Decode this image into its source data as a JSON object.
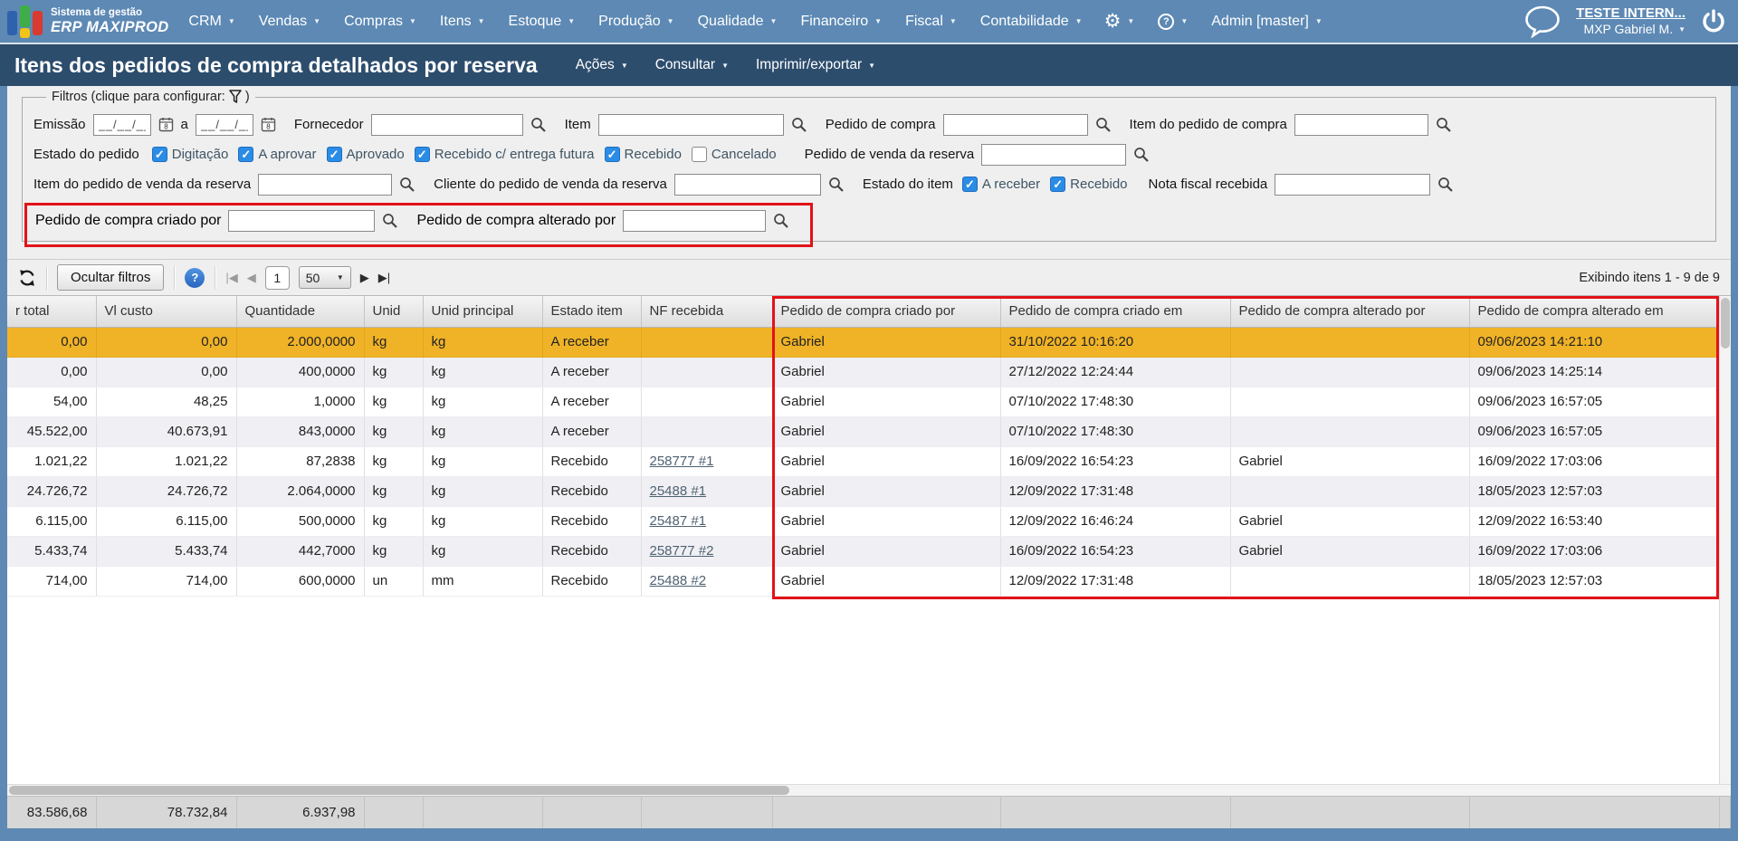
{
  "topnav": {
    "logo_line1": "Sistema de gestão",
    "logo_line2": "ERP MAXIPROD",
    "menus": [
      "CRM",
      "Vendas",
      "Compras",
      "Itens",
      "Estoque",
      "Produção",
      "Qualidade",
      "Financeiro",
      "Fiscal",
      "Contabilidade"
    ],
    "admin_menu": "Admin [master]",
    "account_link": "TESTE INTERN...",
    "user_name": "MXP Gabriel M."
  },
  "titlebar": {
    "title": "Itens dos pedidos de compra detalhados por reserva",
    "menus": [
      "Ações",
      "Consultar",
      "Imprimir/exportar"
    ]
  },
  "filters": {
    "legend_prefix": "Filtros (clique para configurar:",
    "legend_suffix": ")",
    "emissao_label": "Emissão",
    "emissao_from_value": "__/__/__",
    "emissao_to_label": "a",
    "emissao_to_value": "__/__/__",
    "fornecedor_label": "Fornecedor",
    "item_label": "Item",
    "pedido_compra_label": "Pedido de compra",
    "item_pedido_compra_label": "Item do pedido de compra",
    "estado_pedido": {
      "label": "Estado do pedido",
      "options": [
        {
          "label": "Digitação",
          "checked": true
        },
        {
          "label": "A aprovar",
          "checked": true
        },
        {
          "label": "Aprovado",
          "checked": true
        },
        {
          "label": "Recebido c/ entrega futura",
          "checked": true
        },
        {
          "label": "Recebido",
          "checked": true
        },
        {
          "label": "Cancelado",
          "checked": false
        }
      ]
    },
    "pedido_venda_reserva_label": "Pedido de venda da reserva",
    "item_pedido_venda_reserva_label": "Item do pedido de venda da reserva",
    "cliente_pedido_venda_reserva_label": "Cliente do pedido de venda da reserva",
    "estado_item": {
      "label": "Estado do item",
      "options": [
        {
          "label": "A receber",
          "checked": true
        },
        {
          "label": "Recebido",
          "checked": true
        }
      ]
    },
    "nota_fiscal_label": "Nota fiscal recebida",
    "criado_por_label": "Pedido de compra criado por",
    "alterado_por_label": "Pedido de compra alterado por"
  },
  "toolbar": {
    "hide_filters_label": "Ocultar filtros",
    "page_number": "1",
    "page_size": "50",
    "showing_text": "Exibindo itens 1 - 9 de 9"
  },
  "table": {
    "headers": [
      "r total",
      "Vl custo",
      "Quantidade",
      "Unid",
      "Unid principal",
      "Estado item",
      "NF recebida",
      "Pedido de compra criado por",
      "Pedido de compra criado em",
      "Pedido de compra alterado por",
      "Pedido de compra alterado em"
    ],
    "selected_row_index": 0,
    "rows": [
      [
        "0,00",
        "0,00",
        "2.000,0000",
        "kg",
        "kg",
        "A receber",
        "",
        "Gabriel",
        "31/10/2022 10:16:20",
        "",
        "09/06/2023 14:21:10"
      ],
      [
        "0,00",
        "0,00",
        "400,0000",
        "kg",
        "kg",
        "A receber",
        "",
        "Gabriel",
        "27/12/2022 12:24:44",
        "",
        "09/06/2023 14:25:14"
      ],
      [
        "54,00",
        "48,25",
        "1,0000",
        "kg",
        "kg",
        "A receber",
        "",
        "Gabriel",
        "07/10/2022 17:48:30",
        "",
        "09/06/2023 16:57:05"
      ],
      [
        "45.522,00",
        "40.673,91",
        "843,0000",
        "kg",
        "kg",
        "A receber",
        "",
        "Gabriel",
        "07/10/2022 17:48:30",
        "",
        "09/06/2023 16:57:05"
      ],
      [
        "1.021,22",
        "1.021,22",
        "87,2838",
        "kg",
        "kg",
        "Recebido",
        "258777 #1",
        "Gabriel",
        "16/09/2022 16:54:23",
        "Gabriel",
        "16/09/2022 17:03:06"
      ],
      [
        "24.726,72",
        "24.726,72",
        "2.064,0000",
        "kg",
        "kg",
        "Recebido",
        "25488 #1",
        "Gabriel",
        "12/09/2022 17:31:48",
        "",
        "18/05/2023 12:57:03"
      ],
      [
        "6.115,00",
        "6.115,00",
        "500,0000",
        "kg",
        "kg",
        "Recebido",
        "25487 #1",
        "Gabriel",
        "12/09/2022 16:46:24",
        "Gabriel",
        "12/09/2022 16:53:40"
      ],
      [
        "5.433,74",
        "5.433,74",
        "442,7000",
        "kg",
        "kg",
        "Recebido",
        "258777 #2",
        "Gabriel",
        "16/09/2022 16:54:23",
        "Gabriel",
        "16/09/2022 17:03:06"
      ],
      [
        "714,00",
        "714,00",
        "600,0000",
        "un",
        "mm",
        "Recebido",
        "25488 #2",
        "Gabriel",
        "12/09/2022 17:31:48",
        "",
        "18/05/2023 12:57:03"
      ]
    ],
    "footer": [
      "83.586,68",
      "78.732,84",
      "6.937,98",
      "",
      "",
      "",
      "",
      "",
      "",
      "",
      ""
    ]
  },
  "colors": {
    "topnav_blue": "#5d89b4",
    "titlebar_blue": "#2d4d6d",
    "selected_row_orange": "#f0b327",
    "checkbox_blue": "#2b8ce6",
    "highlight_red": "#e31219"
  }
}
